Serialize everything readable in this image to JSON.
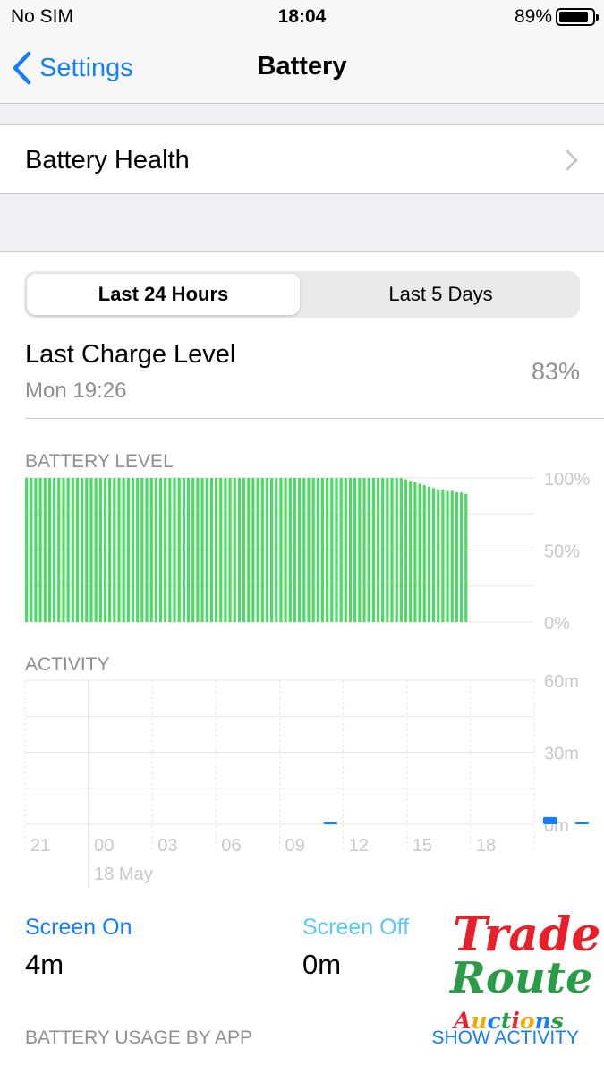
{
  "status_bar": {
    "carrier": "No SIM",
    "time": "18:04",
    "battery_percent": "89%",
    "battery_level": 0.89
  },
  "nav": {
    "back_label": "Settings",
    "title": "Battery"
  },
  "battery_health": {
    "label": "Battery Health"
  },
  "segmented": {
    "options": [
      "Last 24 Hours",
      "Last 5 Days"
    ],
    "selected": "Last 24 Hours"
  },
  "last_charge": {
    "title": "Last Charge Level",
    "time": "Mon 19:26",
    "value": "83%"
  },
  "battery_chart": {
    "label": "BATTERY LEVEL",
    "y_ticks": [
      "100%",
      "50%",
      "0%"
    ],
    "color": "#4cd964"
  },
  "activity_chart": {
    "label": "ACTIVITY",
    "y_ticks": [
      "60m",
      "30m",
      "0m"
    ],
    "x_ticks": [
      "21",
      "00",
      "03",
      "06",
      "09",
      "12",
      "15",
      "18"
    ],
    "date_label": "18 May",
    "color": "#147efb"
  },
  "chart_data": [
    {
      "type": "bar",
      "title": "BATTERY LEVEL",
      "ylim": [
        0,
        100
      ],
      "y_ticks": [
        "100%",
        "50%",
        "0%"
      ],
      "values": [
        100,
        100,
        100,
        100,
        100,
        100,
        100,
        100,
        100,
        100,
        100,
        100,
        100,
        100,
        100,
        100,
        100,
        100,
        100,
        100,
        100,
        100,
        100,
        100,
        100,
        100,
        100,
        100,
        100,
        100,
        100,
        100,
        100,
        100,
        100,
        100,
        100,
        100,
        100,
        100,
        100,
        100,
        100,
        100,
        100,
        100,
        100,
        100,
        100,
        100,
        100,
        100,
        100,
        100,
        100,
        100,
        100,
        100,
        100,
        100,
        100,
        100,
        100,
        100,
        100,
        100,
        100,
        100,
        100,
        100,
        100,
        100,
        100,
        100,
        100,
        100,
        100,
        100,
        100,
        100,
        100,
        100,
        99,
        98,
        97,
        96,
        95,
        94,
        93,
        92,
        92,
        91,
        91,
        90,
        90,
        89
      ]
    },
    {
      "type": "bar",
      "title": "ACTIVITY",
      "ylim": [
        0,
        60
      ],
      "y_ticks": [
        "60m",
        "30m",
        "0m"
      ],
      "x_ticks": [
        "21",
        "00",
        "03",
        "06",
        "09",
        "12",
        "15",
        "18"
      ],
      "x_date_label": "18 May",
      "values": [
        0,
        0,
        0,
        0,
        0,
        0,
        0,
        0,
        0,
        0,
        0,
        0,
        0,
        0,
        0,
        0,
        0,
        0,
        0,
        0,
        0,
        0,
        0,
        0,
        0,
        0,
        0,
        0,
        0,
        0,
        0,
        0,
        0,
        0,
        0,
        0,
        0,
        0,
        0,
        0,
        0,
        0,
        0,
        0,
        0,
        0,
        0,
        0,
        0,
        0,
        0,
        0,
        0,
        0,
        0,
        0,
        0,
        0,
        0,
        0,
        0,
        0,
        0,
        0,
        0,
        0,
        0,
        0,
        0,
        0,
        0,
        0,
        0,
        0,
        0,
        0,
        0,
        0,
        0,
        0,
        0,
        0,
        0,
        0,
        0,
        0,
        0,
        0,
        0,
        0,
        0,
        0,
        0,
        0,
        0,
        0
      ]
    }
  ],
  "activity_marks": [
    {
      "category": 9.6,
      "minutes": 1
    },
    {
      "category": 16.5,
      "minutes": 3
    },
    {
      "category": 17.5,
      "minutes": 1
    }
  ],
  "screen_on": {
    "label": "Screen On",
    "value": "4m"
  },
  "screen_off": {
    "label": "Screen Off",
    "value": "0m"
  },
  "usage": {
    "label": "BATTERY USAGE BY APP",
    "action": "SHOW ACTIVITY"
  },
  "watermark": {
    "line1": "Trade",
    "line2": "Route",
    "line3": "Auctions"
  }
}
